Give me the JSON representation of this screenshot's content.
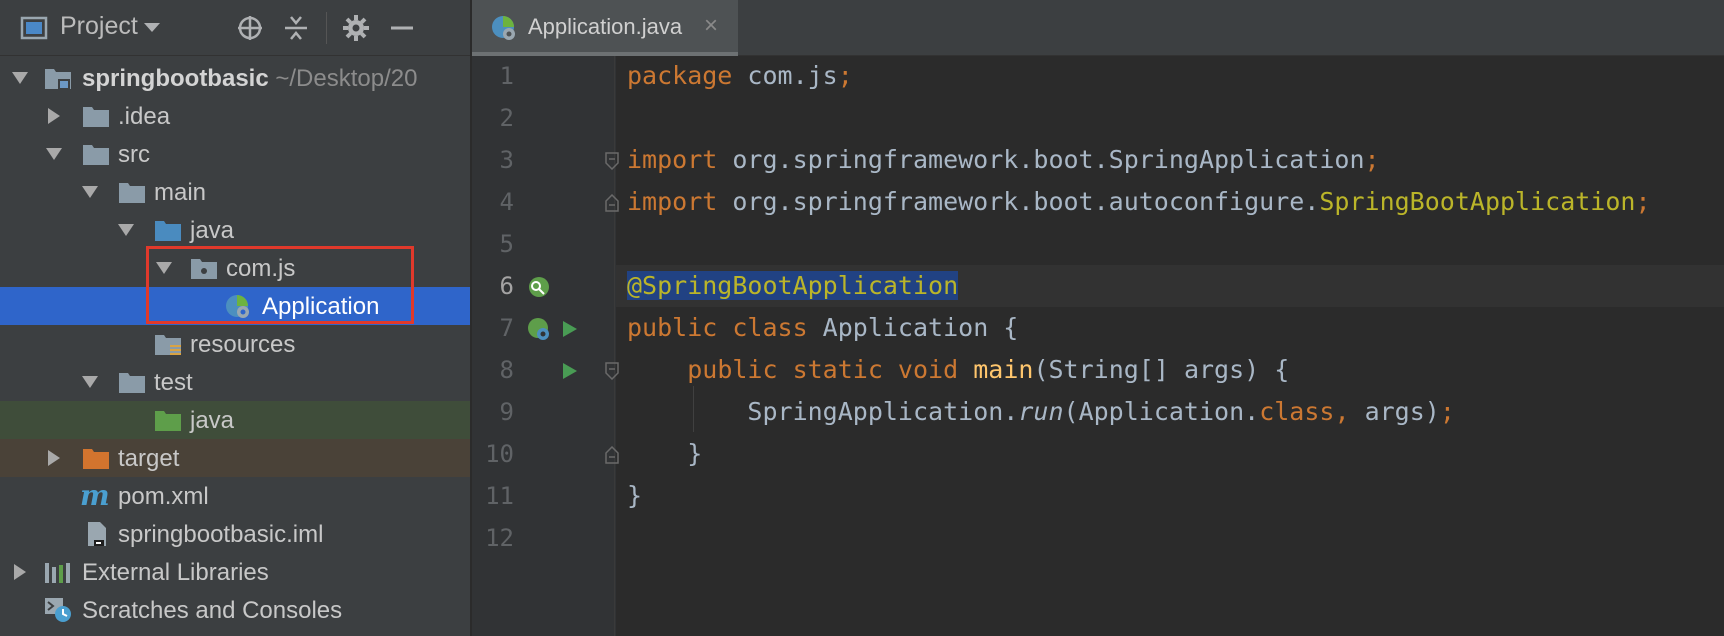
{
  "project_panel": {
    "title": "Project",
    "tree": [
      {
        "label": "springbootbasic",
        "path": "~/Desktop/20",
        "icon": "module-folder-icon",
        "expanded": true,
        "level": 0
      },
      {
        "label": ".idea",
        "icon": "folder-icon",
        "expanded": false,
        "level": 1
      },
      {
        "label": "src",
        "icon": "folder-icon",
        "expanded": true,
        "level": 1
      },
      {
        "label": "main",
        "icon": "folder-icon",
        "expanded": true,
        "level": 2
      },
      {
        "label": "java",
        "icon": "source-folder-icon",
        "expanded": true,
        "level": 3
      },
      {
        "label": "com.js",
        "icon": "package-icon",
        "expanded": true,
        "level": 4
      },
      {
        "label": "Application",
        "icon": "spring-boot-class-icon",
        "selected": true,
        "level": 5
      },
      {
        "label": "resources",
        "icon": "resources-folder-icon",
        "level": 3
      },
      {
        "label": "test",
        "icon": "folder-icon",
        "expanded": true,
        "level": 2
      },
      {
        "label": "java",
        "icon": "test-source-folder-icon",
        "level": 3
      },
      {
        "label": "target",
        "icon": "excluded-folder-icon",
        "expanded": false,
        "level": 1
      },
      {
        "label": "pom.xml",
        "icon": "maven-icon",
        "level": 1
      },
      {
        "label": "springbootbasic.iml",
        "icon": "iml-file-icon",
        "level": 1
      },
      {
        "label": "External Libraries",
        "icon": "libraries-icon",
        "expanded": false,
        "level": 0
      },
      {
        "label": "Scratches and Consoles",
        "icon": "scratches-icon",
        "level": 0
      }
    ]
  },
  "editor": {
    "tab": {
      "label": "Application.java",
      "close": "×"
    },
    "line_numbers": [
      "1",
      "2",
      "3",
      "4",
      "5",
      "6",
      "7",
      "8",
      "9",
      "10",
      "11",
      "12"
    ],
    "current_line": "6",
    "code": {
      "l1": {
        "kw": "package",
        "rest": " com.js",
        "semi": ";"
      },
      "l3": {
        "kw": "import",
        "rest": " org.springframework.boot.SpringApplication",
        "semi": ";"
      },
      "l4": {
        "kw": "import",
        "rest": " org.springframework.boot.autoconfigure.",
        "cls": "SpringBootApplication",
        "semi": ";"
      },
      "l6": {
        "ann": "@SpringBootApplication"
      },
      "l7": {
        "kw": "public class",
        "rest": " Application {"
      },
      "l8": {
        "indent": "    ",
        "kw": "public static void",
        "sp": " ",
        "fn": "main",
        "rest": "(String[] args) {"
      },
      "l9": {
        "indent": "        ",
        "a": "SpringApplication.",
        "it": "run",
        "b": "(Application.",
        "kw": "class",
        "comma": ",",
        "c": " args)",
        "semi": ";"
      },
      "l10": {
        "text": "    }"
      },
      "l11": {
        "text": "}"
      }
    }
  },
  "colors": {
    "keyword": "#cc7832",
    "annotation": "#bbb529",
    "method": "#ffc66d",
    "plain": "#a9b7c6",
    "selection": "#2f65ca",
    "highlight_box": "#e0392b"
  }
}
